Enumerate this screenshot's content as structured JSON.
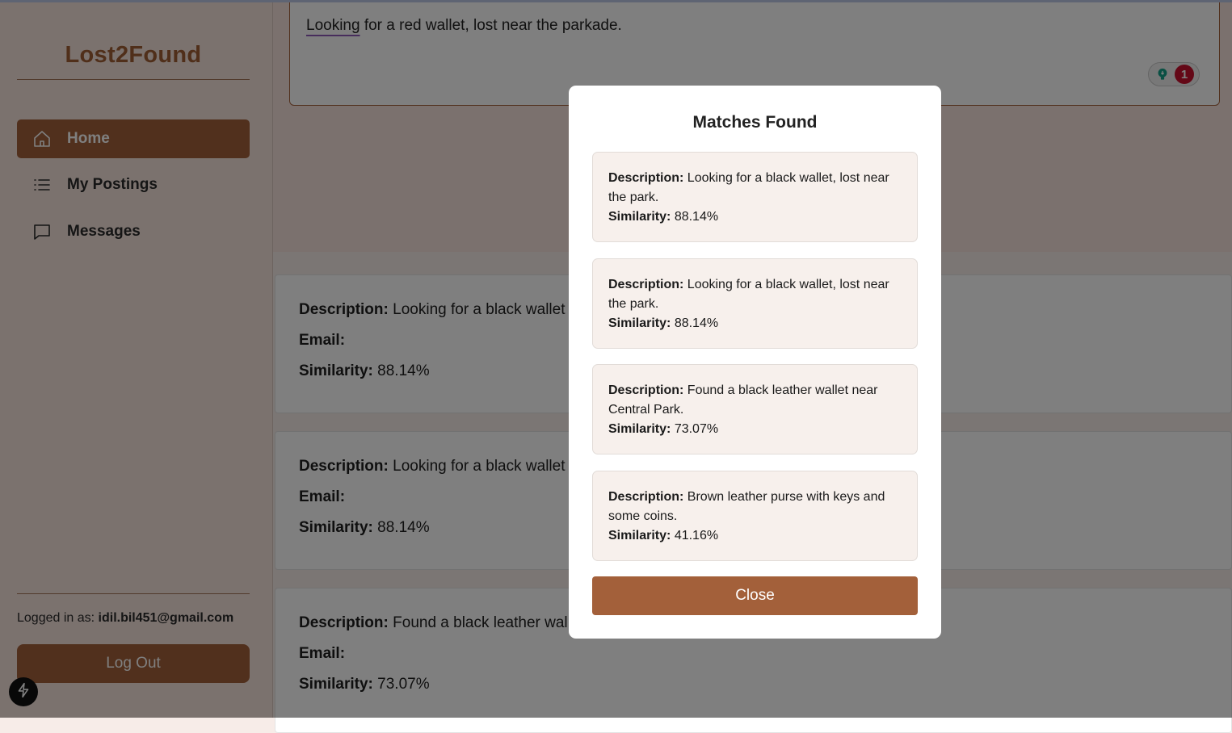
{
  "app": {
    "brand": "Lost2Found"
  },
  "sidebar": {
    "items": [
      {
        "label": "Home",
        "icon": "home-icon",
        "active": true
      },
      {
        "label": "My Postings",
        "icon": "list-icon",
        "active": false
      },
      {
        "label": "Messages",
        "icon": "message-icon",
        "active": false
      }
    ],
    "logged_in_prefix": "Logged in as:",
    "logged_in_email": "idil.bil451@gmail.com",
    "logout_label": "Log Out"
  },
  "search": {
    "text_word1": "Looking",
    "text_rest": " for a red wallet, lost near the parkade.",
    "extension_count": "1"
  },
  "results": [
    {
      "description_label": "Description:",
      "description": "Looking for a black wallet",
      "email_label": "Email:",
      "similarity_label": "Similarity:",
      "similarity": "88.14%"
    },
    {
      "description_label": "Description:",
      "description": "Looking for a black wallet",
      "email_label": "Email:",
      "similarity_label": "Similarity:",
      "similarity": "88.14%"
    },
    {
      "description_label": "Description:",
      "description": "Found a black leather wal",
      "email_label": "Email:",
      "similarity_label": "Similarity:",
      "similarity": "73.07%"
    }
  ],
  "modal": {
    "title": "Matches Found",
    "matches": [
      {
        "description_label": "Description:",
        "description": "Looking for a black wallet, lost near the park.",
        "similarity_label": "Similarity:",
        "similarity": "88.14%"
      },
      {
        "description_label": "Description:",
        "description": "Looking for a black wallet, lost near the park.",
        "similarity_label": "Similarity:",
        "similarity": "88.14%"
      },
      {
        "description_label": "Description:",
        "description": "Found a black leather wallet near Central Park.",
        "similarity_label": "Similarity:",
        "similarity": "73.07%"
      },
      {
        "description_label": "Description:",
        "description": "Brown leather purse with keys and some coins.",
        "similarity_label": "Similarity:",
        "similarity": "41.16%"
      }
    ],
    "close_label": "Close"
  },
  "colors": {
    "brand": "#a05f34",
    "accent": "#a3603a",
    "badge": "#c8102e"
  }
}
